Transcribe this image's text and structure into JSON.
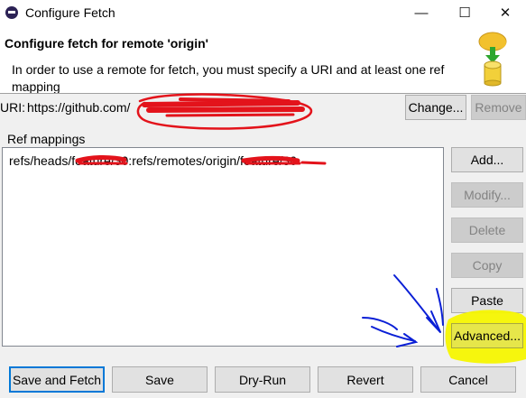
{
  "window": {
    "title": "Configure Fetch",
    "minimize_glyph": "—",
    "maximize_glyph": "☐",
    "close_glyph": "✕"
  },
  "header": {
    "title": "Configure fetch for remote 'origin'",
    "description": "In order to use a remote for fetch, you must specify a URI and at least one ref mapping",
    "graphic_icon": "cloud-fetch-icon"
  },
  "uri": {
    "label": "URI:",
    "value": "https://github.com/",
    "change_label": "Change...",
    "remove_label": "Remove"
  },
  "ref_mappings": {
    "label": "Ref mappings",
    "items": [
      "refs/heads/feature/30:refs/remotes/origin/feature/30"
    ]
  },
  "side_buttons": {
    "add": "Add...",
    "modify": "Modify...",
    "delete": "Delete",
    "copy": "Copy",
    "paste": "Paste",
    "advanced": "Advanced..."
  },
  "footer": {
    "save_and_fetch": "Save and Fetch",
    "save": "Save",
    "dry_run": "Dry-Run",
    "revert": "Revert",
    "cancel": "Cancel"
  },
  "colors": {
    "highlight": "#f5f500",
    "annotation_ink": "#0a1fd6",
    "redaction_ink": "#e3131b",
    "focus_border": "#0078d7"
  }
}
